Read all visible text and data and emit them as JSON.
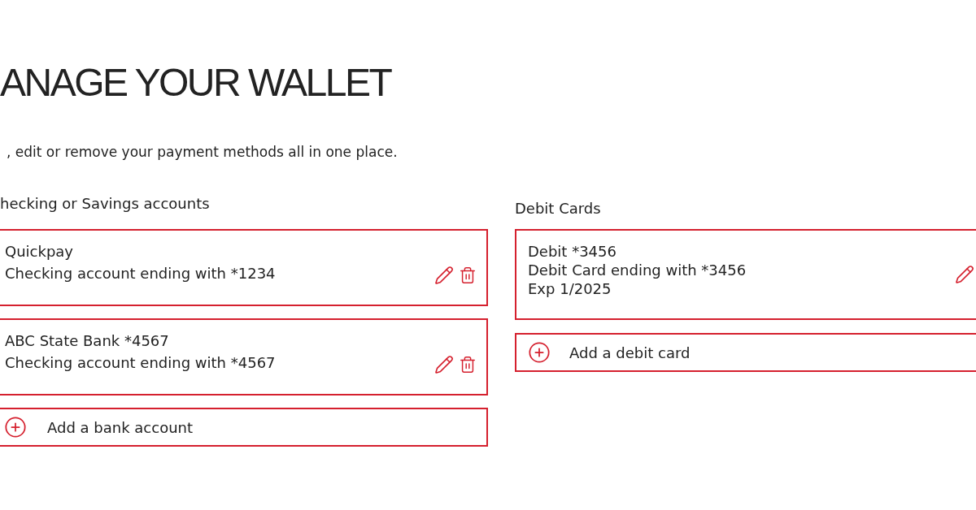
{
  "page": {
    "title": "ANAGE YOUR WALLET",
    "subtitle": ", edit or remove your payment methods all in one place."
  },
  "bank_accounts": {
    "heading": "hecking or Savings accounts",
    "items": [
      {
        "name": "Quickpay",
        "details": [
          "Checking account ending with *1234"
        ]
      },
      {
        "name": "ABC State Bank *4567",
        "details": [
          "Checking account ending with *4567"
        ]
      }
    ],
    "add_label": "Add a bank account"
  },
  "debit_cards": {
    "heading": "Debit Cards",
    "items": [
      {
        "name": "Debit *3456",
        "details": [
          "Debit Card ending with *3456",
          "Exp 1/2025"
        ]
      }
    ],
    "add_label": "Add a debit card"
  }
}
